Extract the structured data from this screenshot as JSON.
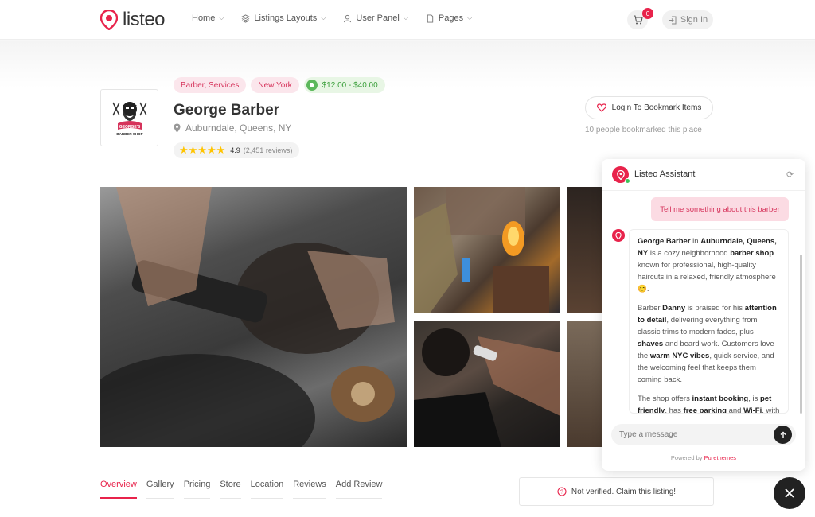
{
  "header": {
    "logo_text": "listeo",
    "nav": [
      {
        "label": "Home"
      },
      {
        "label": "Listings Layouts"
      },
      {
        "label": "User Panel"
      },
      {
        "label": "Pages"
      }
    ],
    "cart_count": "0",
    "signin_label": "Sign In"
  },
  "listing": {
    "logo_text": "GEORGE'S BARBER SHOP",
    "tags": [
      "Barber, Services",
      "New York"
    ],
    "price": "$12.00 - $40.00",
    "title": "George Barber",
    "address": "Auburndale, Queens, NY",
    "stars": "★★★★★",
    "rating": "4.9",
    "reviews": "(2,451 reviews)",
    "bookmark_label": "Login To Bookmark Items",
    "bookmark_note": "10 people bookmarked this place"
  },
  "tabs": [
    "Overview",
    "Gallery",
    "Pricing",
    "Store",
    "Location",
    "Reviews",
    "Add Review"
  ],
  "claim": {
    "label": "Not verified. Claim this listing!"
  },
  "assistant": {
    "title": "Listeo Assistant",
    "user_message": "Tell me something about this barber",
    "input_placeholder": "Type a message",
    "powered_by": "Powered by",
    "powered_brand": "Purethemes",
    "bot_paragraphs": [
      [
        {
          "t": "George Barber",
          "b": true
        },
        {
          "t": " in ",
          "b": false
        },
        {
          "t": "Auburndale, Queens, NY",
          "b": true
        },
        {
          "t": " is a cozy neighborhood ",
          "b": false
        },
        {
          "t": "barber shop",
          "b": true
        },
        {
          "t": " known for professional, high-quality haircuts in a relaxed, friendly atmosphere 😊.",
          "b": false
        }
      ],
      [
        {
          "t": "Barber ",
          "b": false
        },
        {
          "t": "Danny",
          "b": true
        },
        {
          "t": " is praised for his ",
          "b": false
        },
        {
          "t": "attention to detail",
          "b": true
        },
        {
          "t": ", delivering everything from classic trims to modern fades, plus ",
          "b": false
        },
        {
          "t": "shaves",
          "b": true
        },
        {
          "t": " and beard work. Customers love the ",
          "b": false
        },
        {
          "t": "warm NYC vibes",
          "b": true
        },
        {
          "t": ", quick service, and the welcoming feel that keeps them coming back.",
          "b": false
        }
      ],
      [
        {
          "t": "The shop offers ",
          "b": false
        },
        {
          "t": "instant booking",
          "b": true
        },
        {
          "t": ", is ",
          "b": false
        },
        {
          "t": "pet friendly",
          "b": true
        },
        {
          "t": ", has ",
          "b": false
        },
        {
          "t": "free parking",
          "b": true
        },
        {
          "t": " and ",
          "b": false
        },
        {
          "t": "Wi-Fi",
          "b": true
        },
        {
          "t": ", with",
          "b": false
        }
      ]
    ]
  },
  "colors": {
    "accent": "#e8234b",
    "price_green": "#5cb85c",
    "star": "#ffc400"
  }
}
